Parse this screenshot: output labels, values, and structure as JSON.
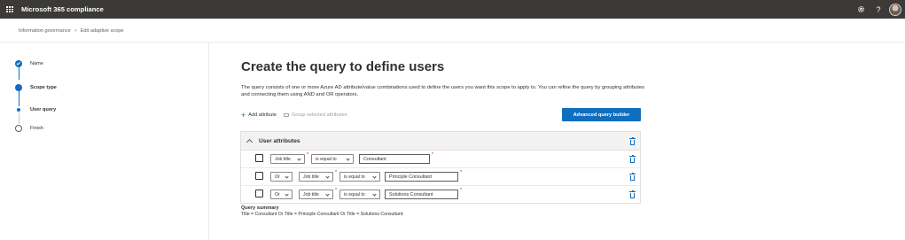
{
  "suite": {
    "app_title": "Microsoft 365 compliance",
    "icons": [
      "waffle-icon",
      "gear-icon",
      "help-icon",
      "avatar"
    ],
    "help_glyph": "?"
  },
  "breadcrumb": {
    "root": "Information governance",
    "separator": ">",
    "current": "Edit adaptive scope"
  },
  "wizard": {
    "steps": [
      {
        "label": "Name",
        "state": "completed"
      },
      {
        "label": "Scope type",
        "state": "current"
      },
      {
        "label": "User query",
        "state": "current-substep"
      },
      {
        "label": "Finish",
        "state": "not-started"
      }
    ]
  },
  "main": {
    "title": "Create the query to define users",
    "description": "The query consists of one or more Azure AD attribute/value combinations used to define the users you want this scope to apply to. You can refine the query by grouping attributes and connecting them using AND and OR operators.",
    "toolbar": {
      "add_attribute": "Add attribute",
      "group_selected": "Group selected attributes"
    },
    "advanced_button": "Advanced query builder",
    "card": {
      "title": "User attributes",
      "required_mark": "*",
      "rows": [
        {
          "connector": "",
          "attribute": "Job title",
          "operator": "is equal to",
          "value": "Consultant"
        },
        {
          "connector": "Or",
          "attribute": "Job title",
          "operator": "is equal to",
          "value": "Principle Consultant"
        },
        {
          "connector": "Or",
          "attribute": "Job title",
          "operator": "is equal to",
          "value": "Solutions Consultant"
        }
      ]
    },
    "summary": {
      "title": "Query summary",
      "text": "Title = Consultant Or Title = Principle Consultant Or Title = Solutions Consultant:"
    }
  },
  "colors": {
    "suite_bar": "#3b3a39",
    "accent": "#106ebe",
    "required": "#a4262c"
  }
}
